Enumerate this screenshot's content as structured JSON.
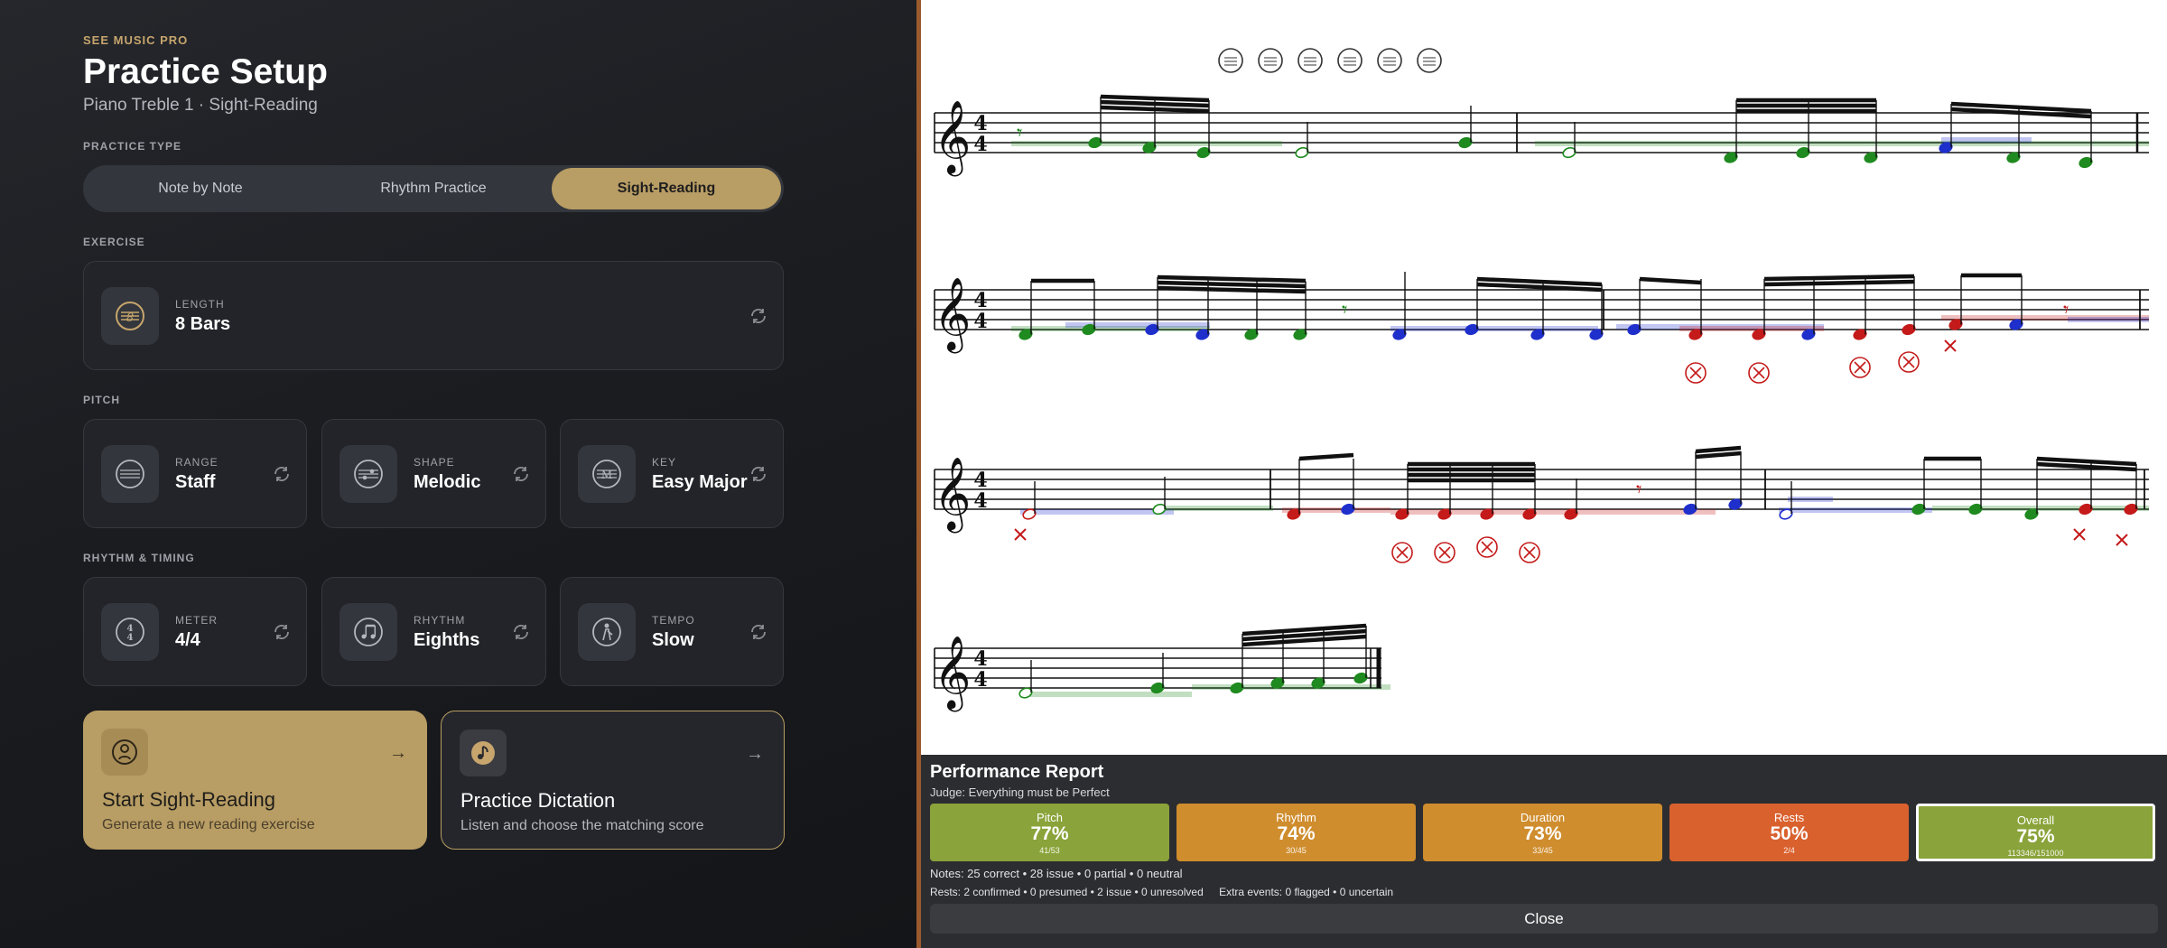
{
  "left": {
    "brand": "SEE MUSIC PRO",
    "title": "Practice Setup",
    "subtitle": "Piano Treble 1 · Sight-Reading",
    "practice_type_label": "PRACTICE TYPE",
    "practice_types": [
      "Note by Note",
      "Rhythm Practice",
      "Sight-Reading"
    ],
    "practice_type_selected": "Sight-Reading",
    "exercise_label": "EXERCISE",
    "length": {
      "label": "LENGTH",
      "value": "8 Bars"
    },
    "pitch_label": "PITCH",
    "range": {
      "label": "RANGE",
      "value": "Staff"
    },
    "shape": {
      "label": "SHAPE",
      "value": "Melodic"
    },
    "key": {
      "label": "KEY",
      "value": "Easy Major"
    },
    "rhythm_timing_label": "RHYTHM & TIMING",
    "meter": {
      "label": "METER",
      "value": "4/4"
    },
    "rhythm": {
      "label": "RHYTHM",
      "value": "Eighths"
    },
    "tempo": {
      "label": "TEMPO",
      "value": "Slow"
    },
    "start_action": {
      "title": "Start Sight-Reading",
      "desc": "Generate a new reading exercise"
    },
    "dictation_action": {
      "title": "Practice Dictation",
      "desc": "Listen and choose the matching score"
    }
  },
  "colors": {
    "accent": "#b89d64",
    "correct": "#1f8a1f",
    "partial": "#1f2fcc",
    "issue": "#c41a1a",
    "metric_good": "#8aa33a",
    "metric_mid": "#cf8d2e",
    "metric_bad": "#d9612e"
  },
  "score": {
    "toolbar_icons": [
      "score-icon",
      "notes-icon",
      "clef-icon",
      "meter-icon",
      "tempo-icon",
      "music-note-icon"
    ],
    "time_signature": [
      "4",
      "4"
    ]
  },
  "report": {
    "title": "Performance Report",
    "judge": "Judge: Everything must be Perfect",
    "metrics": [
      {
        "label": "Pitch",
        "value": "77%",
        "sub": "41/53",
        "color": "#8aa33a"
      },
      {
        "label": "Rhythm",
        "value": "74%",
        "sub": "30/45",
        "color": "#cf8d2e"
      },
      {
        "label": "Duration",
        "value": "73%",
        "sub": "33/45",
        "color": "#cf8d2e"
      },
      {
        "label": "Rests",
        "value": "50%",
        "sub": "2/4",
        "color": "#d9612e"
      },
      {
        "label": "Overall",
        "value": "75%",
        "sub": "113346/151000",
        "color": "#8aa33a"
      }
    ],
    "notes_line": "Notes: 25 correct • 28 issue • 0 partial • 0 neutral",
    "rests_line": "Rests: 2 confirmed • 0 presumed • 2 issue • 0 unresolved",
    "extra_line": "Extra events: 0 flagged • 0 uncertain",
    "close_label": "Close"
  }
}
